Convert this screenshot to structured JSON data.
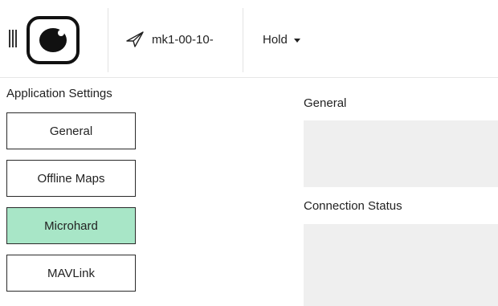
{
  "toolbar": {
    "menu_icon": "hamburger-icon",
    "logo_icon": "app-logo-icon",
    "vehicle": {
      "icon": "paper-plane-icon",
      "label": "mk1-00-10-"
    },
    "flight_mode": {
      "label": "Hold",
      "icon": "caret-down-icon"
    }
  },
  "sidebar": {
    "title": "Application Settings",
    "items": [
      {
        "label": "General",
        "active": false
      },
      {
        "label": "Offline Maps",
        "active": false
      },
      {
        "label": "Microhard",
        "active": true
      },
      {
        "label": "MAVLink",
        "active": false
      }
    ],
    "active_color": "#a8e6c7"
  },
  "main": {
    "sections": [
      {
        "title": "General"
      },
      {
        "title": "Connection Status"
      }
    ],
    "panel_color": "#efefef"
  }
}
